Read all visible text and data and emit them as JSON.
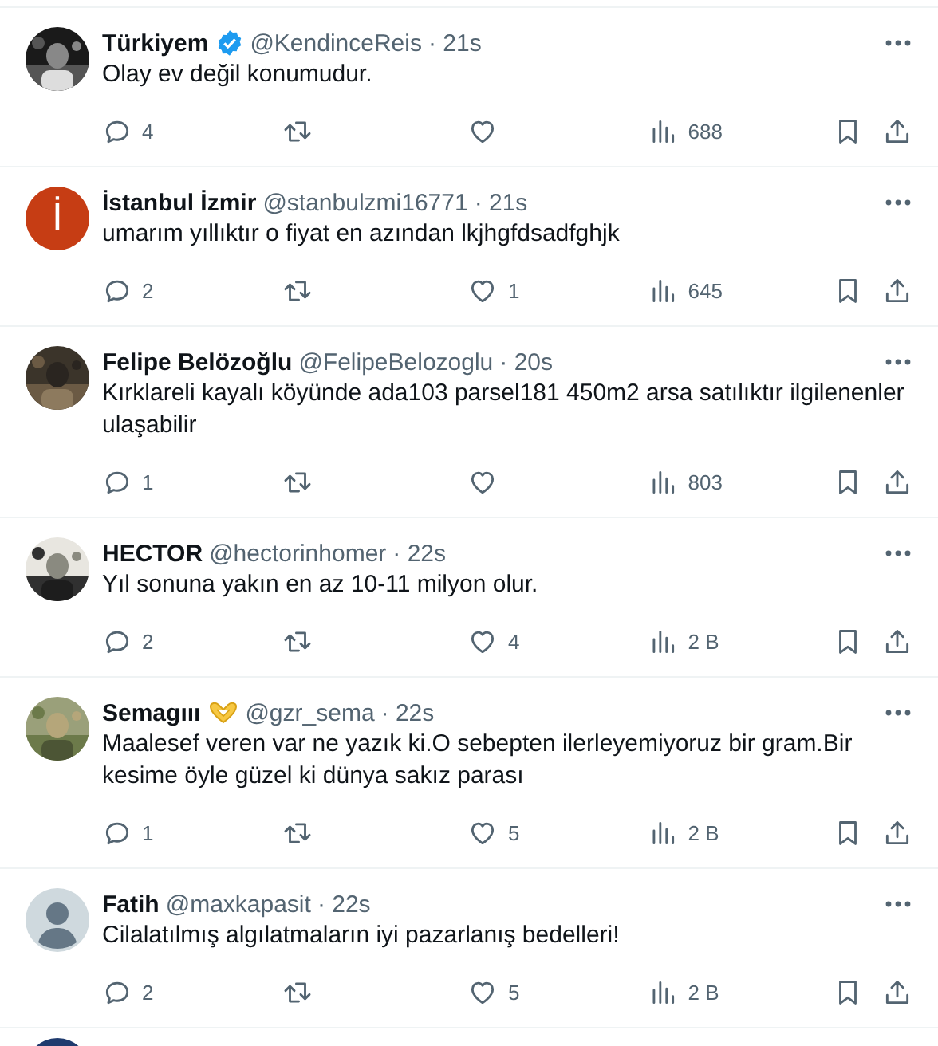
{
  "tweets": [
    {
      "kind": "tweet",
      "name": "Türkiyem",
      "badge": {
        "kind": "verified"
      },
      "handle": "@KendinceReis",
      "time": "· 21s",
      "text": "Olay ev değil konumudur.",
      "replies": "4",
      "views": "688"
    },
    {
      "kind": "tweet",
      "avatar": {
        "kind": "letter",
        "letter": "İ"
      },
      "name": "İstanbul İzmir",
      "handle": "@stanbulzmi16771",
      "time": "· 21s",
      "text": "umarım yıllıktır o fiyat en azından lkjhgfdsadfghjk",
      "replies": "2",
      "likes": "1",
      "views": "645"
    },
    {
      "kind": "tweet",
      "name": "Felipe Belözoğlu",
      "handle": "@FelipeBelozoglu",
      "time": "· 20s",
      "text": "Kırklareli kayalı köyünde ada103 parsel181 450m2 arsa satılıktır ilgilenenler ulaşabilir",
      "replies": "1",
      "views": "803"
    },
    {
      "kind": "tweet",
      "name": "HECTOR",
      "handle": "@hectorinhomer",
      "time": "· 22s",
      "text": "Yıl sonuna yakın en az 10-11 milyon olur.",
      "replies": "2",
      "likes": "4",
      "views": "2 B"
    },
    {
      "kind": "tweet",
      "name": "Semagııı",
      "badge": {
        "kind": "heart-hands"
      },
      "handle": "@gzr_sema",
      "time": "· 22s",
      "text": "Maalesef veren var ne yazık ki.O sebepten ilerleyemiyoruz bir gram.Bir kesime öyle güzel ki dünya sakız parası",
      "replies": "1",
      "likes": "5",
      "views": "2 B"
    },
    {
      "kind": "tweet",
      "avatar": {
        "kind": "default"
      },
      "name": "Fatih",
      "handle": "@maxkapasit",
      "time": "· 22s",
      "text": "Cilalatılmış algılatmaların iyi pazarlanış bedelleri!",
      "replies": "2",
      "likes": "5",
      "views": "2 B"
    },
    {
      "kind": "partial"
    }
  ]
}
